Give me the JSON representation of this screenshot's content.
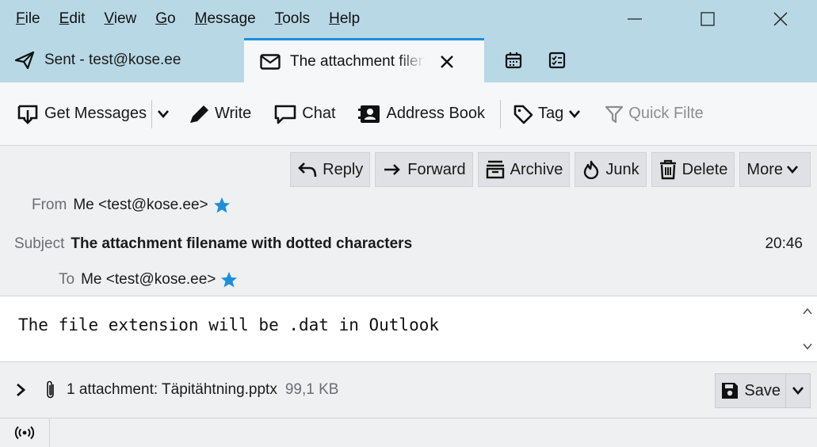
{
  "menubar": {
    "items": [
      {
        "first": "F",
        "rest": "ile"
      },
      {
        "first": "E",
        "rest": "dit"
      },
      {
        "first": "V",
        "rest": "iew"
      },
      {
        "first": "G",
        "rest": "o"
      },
      {
        "first": "M",
        "rest": "essage"
      },
      {
        "first": "T",
        "rest": "ools"
      },
      {
        "first": "H",
        "rest": "elp"
      }
    ]
  },
  "tabs": {
    "sent": "Sent - test@kose.ee",
    "active": "The attachment filename with dotted characters"
  },
  "toolbar": {
    "get_messages": "Get Messages",
    "write": "Write",
    "chat": "Chat",
    "address_book": "Address Book",
    "tag": "Tag",
    "quick_filter": "Quick Filte"
  },
  "header_buttons": {
    "reply": "Reply",
    "forward": "Forward",
    "archive": "Archive",
    "junk": "Junk",
    "delete": "Delete",
    "more": "More"
  },
  "header": {
    "from_label": "From",
    "from_value": "Me <test@kose.ee>",
    "subject_label": "Subject",
    "subject_value": "The attachment filename with dotted characters",
    "time": "20:46",
    "to_label": "To",
    "to_value": "Me <test@kose.ee>"
  },
  "body": {
    "text": "The file extension will be .dat in Outlook"
  },
  "attachment": {
    "summary": "1 attachment: Täpitähtning.pptx",
    "size": "99,1 KB",
    "save_label": "Save"
  },
  "colors": {
    "titlebar": "#b8d8e6",
    "accent": "#1c8fdb",
    "star": "#1c8fdb"
  }
}
